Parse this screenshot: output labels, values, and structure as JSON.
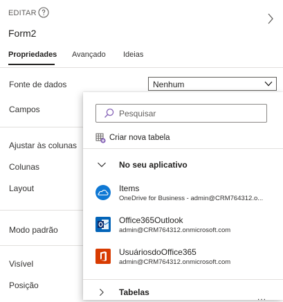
{
  "header": {
    "mode_label": "EDITAR",
    "title": "Form2"
  },
  "tabs": [
    {
      "label": "Propriedades",
      "active": true
    },
    {
      "label": "Avançado",
      "active": false
    },
    {
      "label": "Ideias",
      "active": false
    }
  ],
  "properties": {
    "data_source_label": "Fonte de dados",
    "data_source_value": "Nenhum",
    "fields_label": "Campos",
    "snap_columns_label": "Ajustar às colunas",
    "columns_label": "Colunas",
    "layout_label": "Layout",
    "default_mode_label": "Modo padrão",
    "visible_label": "Visível",
    "position_label": "Posição"
  },
  "dropdown": {
    "search_placeholder": "Pesquisar",
    "create_table_label": "Criar nova tabela",
    "in_app_section": "No seu aplicativo",
    "items": [
      {
        "title": "Items",
        "subtitle": "OneDrive for Business - admin@CRM764312.o...",
        "icon": "onedrive-icon"
      },
      {
        "title": "Office365Outlook",
        "subtitle": "admin@CRM764312.onmicrosoft.com",
        "icon": "outlook-icon"
      },
      {
        "title": "UsuáriosdoOffice365",
        "subtitle": "admin@CRM764312.onmicrosoft.com",
        "icon": "office365-icon"
      }
    ],
    "tables_section": "Tabelas",
    "more_label": "..."
  },
  "colors": {
    "accent_purple": "#8764b8",
    "onedrive_blue": "#0f78d4",
    "outlook_blue": "#0364b8",
    "office_red": "#d83b01"
  }
}
